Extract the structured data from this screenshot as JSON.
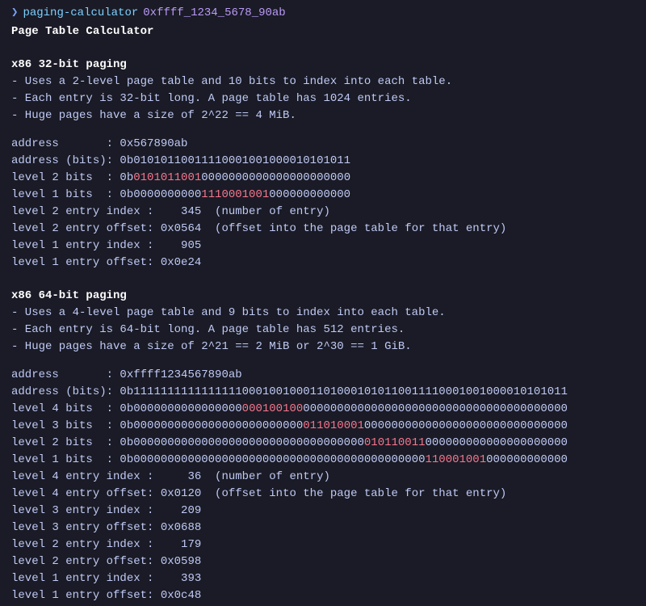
{
  "prompt": {
    "arrow": "❯",
    "command": "paging-calculator",
    "arg": "0xffff_1234_5678_90ab"
  },
  "title": "Page Table Calculator",
  "x86_32": {
    "header": "x86 32-bit paging",
    "bullet1": "- Uses a 2-level page table and 10 bits to index into each table.",
    "bullet2": "- Each entry is 32-bit long. A page table has 1024 entries.",
    "bullet3": "- Huge pages have a size of 2^22 == 4 MiB.",
    "address_label": "address       :",
    "address_value": " 0x567890ab",
    "address_bits_label": "address (bits):",
    "address_bits_value": " 0b01010110011110001001000010101011",
    "l2_bits_label": "level 2 bits  :",
    "l2_bits_pre": " 0b",
    "l2_bits_hl": "0101011001",
    "l2_bits_post": "0000000000000000000000",
    "l1_bits_label": "level 1 bits  :",
    "l1_bits_pre": " 0b0000000000",
    "l1_bits_hl": "1110001001",
    "l1_bits_post": "000000000000",
    "l2_idx_label": "level 2 entry index :",
    "l2_idx_value": "    345",
    "l2_idx_comment": "  (number of entry)",
    "l2_off_label": "level 2 entry offset:",
    "l2_off_value": " 0x0564",
    "l2_off_comment": "  (offset into the page table for that entry)",
    "l1_idx_label": "level 1 entry index :",
    "l1_idx_value": "    905",
    "l1_off_label": "level 1 entry offset:",
    "l1_off_value": " 0x0e24"
  },
  "x86_64": {
    "header": "x86 64-bit paging",
    "bullet1": "- Uses a 4-level page table and 9 bits to index into each table.",
    "bullet2": "- Each entry is 64-bit long. A page table has 512 entries.",
    "bullet3": "- Huge pages have a size of 2^21 == 2 MiB or 2^30 == 1 GiB.",
    "address_label": "address       :",
    "address_value": " 0xffff1234567890ab",
    "address_bits_label": "address (bits):",
    "address_bits_value": " 0b1111111111111111000100100011010001010110011110001001000010101011",
    "l4_bits_label": "level 4 bits  :",
    "l4_bits_pre": " 0b0000000000000000",
    "l4_bits_hl": "000100100",
    "l4_bits_post": "000000000000000000000000000000000000000",
    "l3_bits_label": "level 3 bits  :",
    "l3_bits_pre": " 0b0000000000000000000000000",
    "l3_bits_hl": "011010001",
    "l3_bits_post": "000000000000000000000000000000",
    "l2_bits_label": "level 2 bits  :",
    "l2_bits_pre": " 0b0000000000000000000000000000000000",
    "l2_bits_hl": "010110011",
    "l2_bits_post": "000000000000000000000",
    "l1_bits_label": "level 1 bits  :",
    "l1_bits_pre": " 0b0000000000000000000000000000000000000000000",
    "l1_bits_hl": "110001001",
    "l1_bits_post": "000000000000",
    "l4_idx_label": "level 4 entry index :",
    "l4_idx_value": "     36",
    "l4_idx_comment": "  (number of entry)",
    "l4_off_label": "level 4 entry offset:",
    "l4_off_value": " 0x0120",
    "l4_off_comment": "  (offset into the page table for that entry)",
    "l3_idx_label": "level 3 entry index :",
    "l3_idx_value": "    209",
    "l3_off_label": "level 3 entry offset:",
    "l3_off_value": " 0x0688",
    "l2_idx_label": "level 2 entry index :",
    "l2_idx_value": "    179",
    "l2_off_label": "level 2 entry offset:",
    "l2_off_value": " 0x0598",
    "l1_idx_label": "level 1 entry index :",
    "l1_idx_value": "    393",
    "l1_off_label": "level 1 entry offset:",
    "l1_off_value": " 0x0c48"
  }
}
